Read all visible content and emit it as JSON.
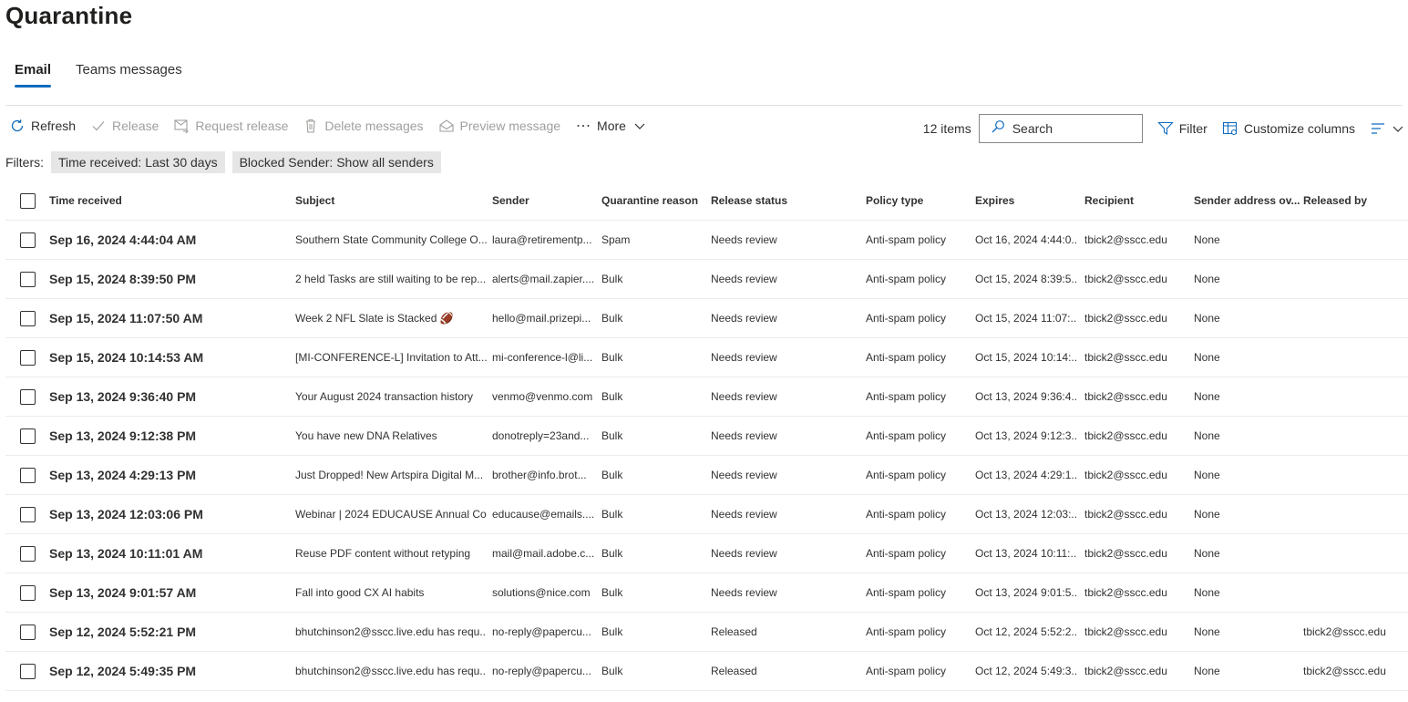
{
  "page": {
    "title": "Quarantine"
  },
  "tabs": [
    {
      "label": "Email",
      "active": true
    },
    {
      "label": "Teams messages",
      "active": false
    }
  ],
  "toolbar": {
    "refresh": "Refresh",
    "release": "Release",
    "request_release": "Request release",
    "delete_messages": "Delete messages",
    "preview_message": "Preview message",
    "more": "More",
    "item_count": "12 items",
    "search_placeholder": "Search",
    "filter": "Filter",
    "customize_columns": "Customize columns"
  },
  "filters": {
    "label": "Filters:",
    "chips": [
      {
        "name": "Time received:",
        "value": "Last 30 days"
      },
      {
        "name": "Blocked Sender:",
        "value": "Show all senders"
      }
    ]
  },
  "table": {
    "columns": [
      "Time received",
      "Subject",
      "Sender",
      "Quarantine reason",
      "Release status",
      "Policy type",
      "Expires",
      "Recipient",
      "Sender address ov...",
      "Released by"
    ],
    "rows": [
      [
        "Sep 16, 2024 4:44:04 AM",
        "Southern State Community College O...",
        "laura@retirementp...",
        "Spam",
        "Needs review",
        "Anti-spam policy",
        "Oct 16, 2024 4:44:0...",
        "tbick2@sscc.edu",
        "None",
        ""
      ],
      [
        "Sep 15, 2024 8:39:50 PM",
        "2 held Tasks are still waiting to be rep...",
        "alerts@mail.zapier....",
        "Bulk",
        "Needs review",
        "Anti-spam policy",
        "Oct 15, 2024 8:39:5...",
        "tbick2@sscc.edu",
        "None",
        ""
      ],
      [
        "Sep 15, 2024 11:07:50 AM",
        "Week 2 NFL Slate is Stacked 🏈",
        "hello@mail.prizepi...",
        "Bulk",
        "Needs review",
        "Anti-spam policy",
        "Oct 15, 2024 11:07:...",
        "tbick2@sscc.edu",
        "None",
        ""
      ],
      [
        "Sep 15, 2024 10:14:53 AM",
        "[MI-CONFERENCE-L] Invitation to Att...",
        "mi-conference-l@li...",
        "Bulk",
        "Needs review",
        "Anti-spam policy",
        "Oct 15, 2024 10:14:...",
        "tbick2@sscc.edu",
        "None",
        ""
      ],
      [
        "Sep 13, 2024 9:36:40 PM",
        "Your August 2024 transaction history",
        "venmo@venmo.com",
        "Bulk",
        "Needs review",
        "Anti-spam policy",
        "Oct 13, 2024 9:36:4...",
        "tbick2@sscc.edu",
        "None",
        ""
      ],
      [
        "Sep 13, 2024 9:12:38 PM",
        "You have new DNA Relatives",
        "donotreply=23and...",
        "Bulk",
        "Needs review",
        "Anti-spam policy",
        "Oct 13, 2024 9:12:3...",
        "tbick2@sscc.edu",
        "None",
        ""
      ],
      [
        "Sep 13, 2024 4:29:13 PM",
        "Just Dropped! New Artspira Digital M...",
        "brother@info.brot...",
        "Bulk",
        "Needs review",
        "Anti-spam policy",
        "Oct 13, 2024 4:29:1...",
        "tbick2@sscc.edu",
        "None",
        ""
      ],
      [
        "Sep 13, 2024 12:03:06 PM",
        "Webinar | 2024 EDUCAUSE Annual Co...",
        "educause@emails....",
        "Bulk",
        "Needs review",
        "Anti-spam policy",
        "Oct 13, 2024 12:03:...",
        "tbick2@sscc.edu",
        "None",
        ""
      ],
      [
        "Sep 13, 2024 10:11:01 AM",
        "Reuse PDF content without retyping",
        "mail@mail.adobe.c...",
        "Bulk",
        "Needs review",
        "Anti-spam policy",
        "Oct 13, 2024 10:11:...",
        "tbick2@sscc.edu",
        "None",
        ""
      ],
      [
        "Sep 13, 2024 9:01:57 AM",
        "Fall into good CX AI habits",
        "solutions@nice.com",
        "Bulk",
        "Needs review",
        "Anti-spam policy",
        "Oct 13, 2024 9:01:5...",
        "tbick2@sscc.edu",
        "None",
        ""
      ],
      [
        "Sep 12, 2024 5:52:21 PM",
        "bhutchinson2@sscc.live.edu has requ...",
        "no-reply@papercu...",
        "Bulk",
        "Released",
        "Anti-spam policy",
        "Oct 12, 2024 5:52:2...",
        "tbick2@sscc.edu",
        "None",
        "tbick2@sscc.edu"
      ],
      [
        "Sep 12, 2024 5:49:35 PM",
        "bhutchinson2@sscc.live.edu has requ...",
        "no-reply@papercu...",
        "Bulk",
        "Released",
        "Anti-spam policy",
        "Oct 12, 2024 5:49:3...",
        "tbick2@sscc.edu",
        "None",
        "tbick2@sscc.edu"
      ]
    ]
  },
  "icons": {
    "refresh": "refresh-icon",
    "release": "checkmark-icon",
    "request_release": "request-release-icon",
    "delete": "trash-icon",
    "preview": "envelope-open-icon",
    "more": "ellipsis-icon",
    "search": "search-icon",
    "filter": "filter-icon",
    "customize": "table-settings-icon",
    "view": "list-view-icon"
  },
  "colors": {
    "accent": "#0f6cbd",
    "chip_bg": "#e6e6e6",
    "disabled": "#a19f9d"
  }
}
